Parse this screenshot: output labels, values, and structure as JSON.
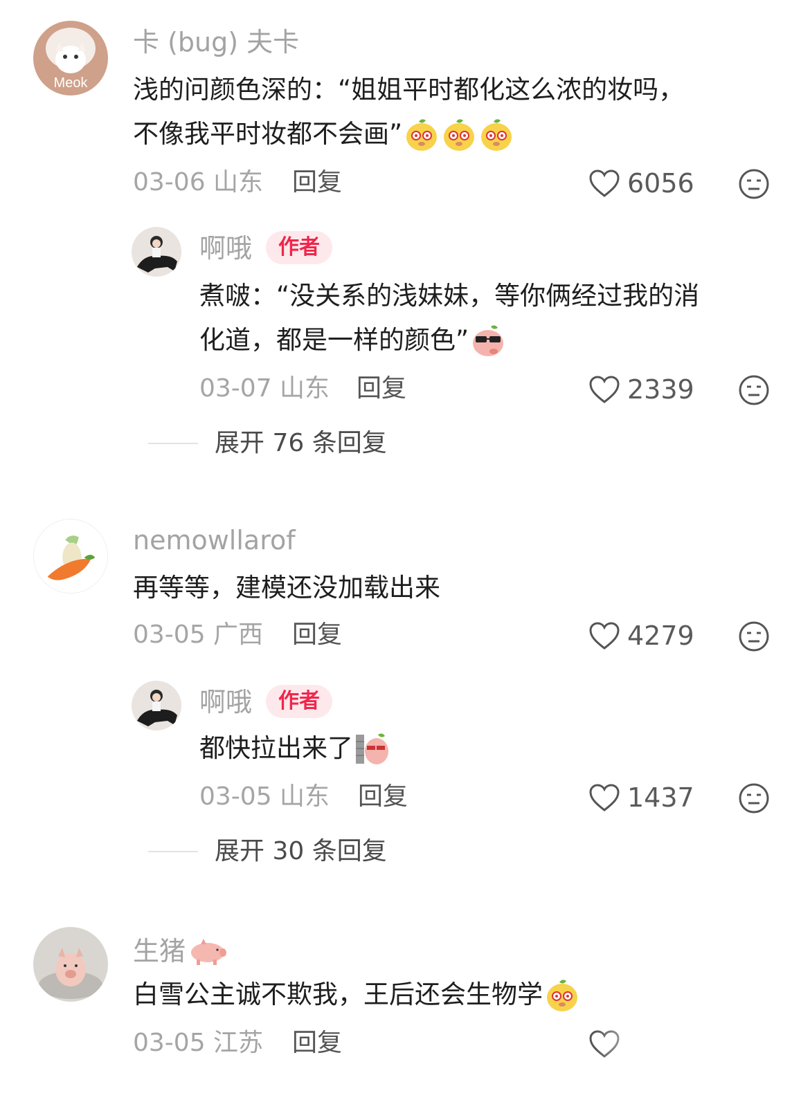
{
  "comments": [
    {
      "username": "卡 (bug) 夫卡",
      "avatar_label": "Meok",
      "content_line1": "浅的问颜色深的：“姐姐平时都化这么浓的妆吗，",
      "content_line2": "不像我平时妆都不会画”",
      "emojis": [
        "mango-face-emoji",
        "mango-face-emoji",
        "mango-face-emoji"
      ],
      "date_location": "03-06 山东",
      "reply_label": "回复",
      "likes": "6056"
    },
    {
      "username": "啊哦",
      "badge": "作者",
      "content_line1": "煮啵：“没关系的浅妹妹，等你俩经过我的消",
      "content_line2": "化道，都是一样的颜色”",
      "date_location": "03-07 山东",
      "reply_label": "回复",
      "likes": "2339",
      "expand_label": "展开 76 条回复"
    },
    {
      "username": "nemowllarof",
      "content_line1": "再等等，建模还没加载出来",
      "date_location": "03-05 广西",
      "reply_label": "回复",
      "likes": "4279"
    },
    {
      "username": "啊哦",
      "badge": "作者",
      "content_line1": "都快拉出来了",
      "date_location": "03-05 山东",
      "reply_label": "回复",
      "likes": "1437",
      "expand_label": "展开 30 条回复"
    },
    {
      "username": "生猪",
      "content_line1": "白雪公主诚不欺我，王后还会生物学",
      "date_location": "03-05 江苏",
      "reply_label": "回复"
    }
  ],
  "colors": {
    "username": "#a3a3a3",
    "author_badge_bg": "#fde9ec",
    "author_badge_text": "#f0264b",
    "meta": "#a5a5a5",
    "content": "#1e1e1e"
  }
}
